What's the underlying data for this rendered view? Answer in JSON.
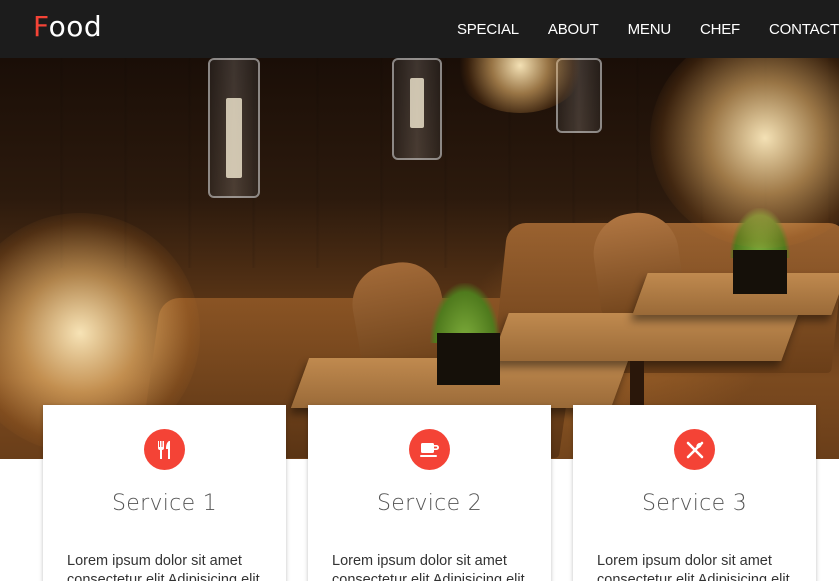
{
  "navbar": {
    "brand_first": "F",
    "brand_rest": "ood",
    "accent_color": "#f44336",
    "background": "#1c1c1c",
    "links": [
      {
        "label": "SPECIAL"
      },
      {
        "label": "ABOUT"
      },
      {
        "label": "MENU"
      },
      {
        "label": "CHEF"
      },
      {
        "label": "CONTACT"
      }
    ]
  },
  "hero": {
    "image": "restaurant-interior-photo"
  },
  "services": [
    {
      "icon": "fork-knife-icon",
      "title": "Service 1",
      "text": "Lorem ipsum dolor sit amet consectetur elit Adipisicing elit"
    },
    {
      "icon": "coffee-cup-icon",
      "title": "Service 2",
      "text": "Lorem ipsum dolor sit amet consectetur elit Adipisicing elit"
    },
    {
      "icon": "utensils-crossed-icon",
      "title": "Service 3",
      "text": "Lorem ipsum dolor sit amet consectetur elit Adipisicing elit"
    }
  ]
}
